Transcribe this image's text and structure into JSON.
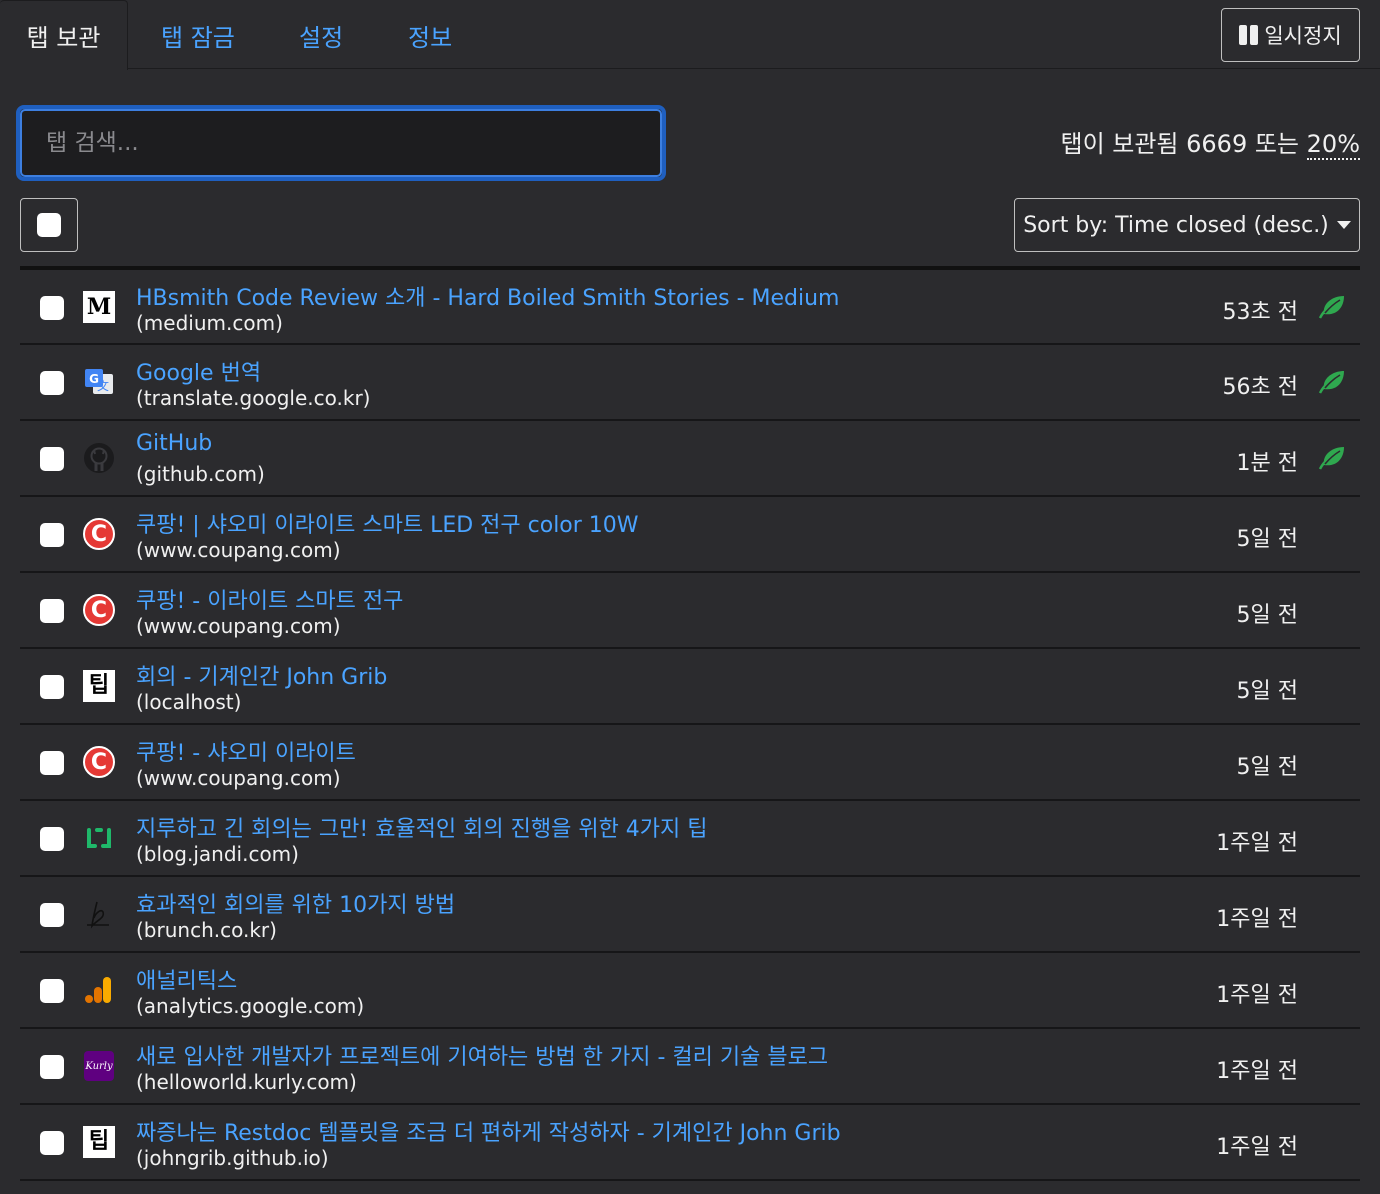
{
  "tabs": [
    {
      "label": "탭 보관",
      "active": true
    },
    {
      "label": "탭 잠금",
      "active": false
    },
    {
      "label": "설정",
      "active": false
    },
    {
      "label": "정보",
      "active": false
    }
  ],
  "pause_button": {
    "label": "일시정지",
    "icon": "pause-icon"
  },
  "search": {
    "placeholder": "탭 검색...",
    "value": ""
  },
  "stats": {
    "prefix": "탭이 보관됨 6669 또는",
    "percent": "20%"
  },
  "sort": {
    "label": "Sort by: Time closed (desc.)",
    "icon": "caret-down-icon"
  },
  "colors": {
    "accent": "#4aa3ff",
    "background": "#2b2b2e",
    "leaf": "#2fa84f"
  },
  "items": [
    {
      "title": "HBsmith Code Review 소개 - Hard Boiled Smith Stories - Medium",
      "domain": "(medium.com)",
      "time": "53초 전",
      "favicon": "medium-icon",
      "leaf": true
    },
    {
      "title": "Google 번역",
      "domain": "(translate.google.co.kr)",
      "time": "56초 전",
      "favicon": "google-translate-icon",
      "leaf": true
    },
    {
      "title": "GitHub",
      "domain": "(github.com)",
      "time": "1분 전",
      "favicon": "github-icon",
      "leaf": true
    },
    {
      "title": "쿠팡! | 샤오미 이라이트 스마트 LED 전구 color 10W",
      "domain": "(www.coupang.com)",
      "time": "5일 전",
      "favicon": "coupang-icon",
      "leaf": false
    },
    {
      "title": "쿠팡! - 이라이트 스마트 전구",
      "domain": "(www.coupang.com)",
      "time": "5일 전",
      "favicon": "coupang-icon",
      "leaf": false
    },
    {
      "title": "회의 - 기계인간 John Grib",
      "domain": "(localhost)",
      "time": "5일 전",
      "favicon": "tip-icon",
      "leaf": false
    },
    {
      "title": "쿠팡! - 샤오미 이라이트",
      "domain": "(www.coupang.com)",
      "time": "5일 전",
      "favicon": "coupang-icon",
      "leaf": false
    },
    {
      "title": "지루하고 긴 회의는 그만! 효율적인 회의 진행을 위한 4가지 팁",
      "domain": "(blog.jandi.com)",
      "time": "1주일 전",
      "favicon": "jandi-icon",
      "leaf": false
    },
    {
      "title": "효과적인 회의를 위한 10가지 방법",
      "domain": "(brunch.co.kr)",
      "time": "1주일 전",
      "favicon": "brunch-icon",
      "leaf": false
    },
    {
      "title": "애널리틱스",
      "domain": "(analytics.google.com)",
      "time": "1주일 전",
      "favicon": "analytics-icon",
      "leaf": false
    },
    {
      "title": "새로 입사한 개발자가 프로젝트에 기여하는 방법 한 가지 - 컬리 기술 블로그",
      "domain": "(helloworld.kurly.com)",
      "time": "1주일 전",
      "favicon": "kurly-icon",
      "leaf": false
    },
    {
      "title": "짜증나는 Restdoc 템플릿을 조금 더 편하게 작성하자 - 기계인간 John Grib",
      "domain": "(johngrib.github.io)",
      "time": "1주일 전",
      "favicon": "tip-icon",
      "leaf": false
    }
  ]
}
